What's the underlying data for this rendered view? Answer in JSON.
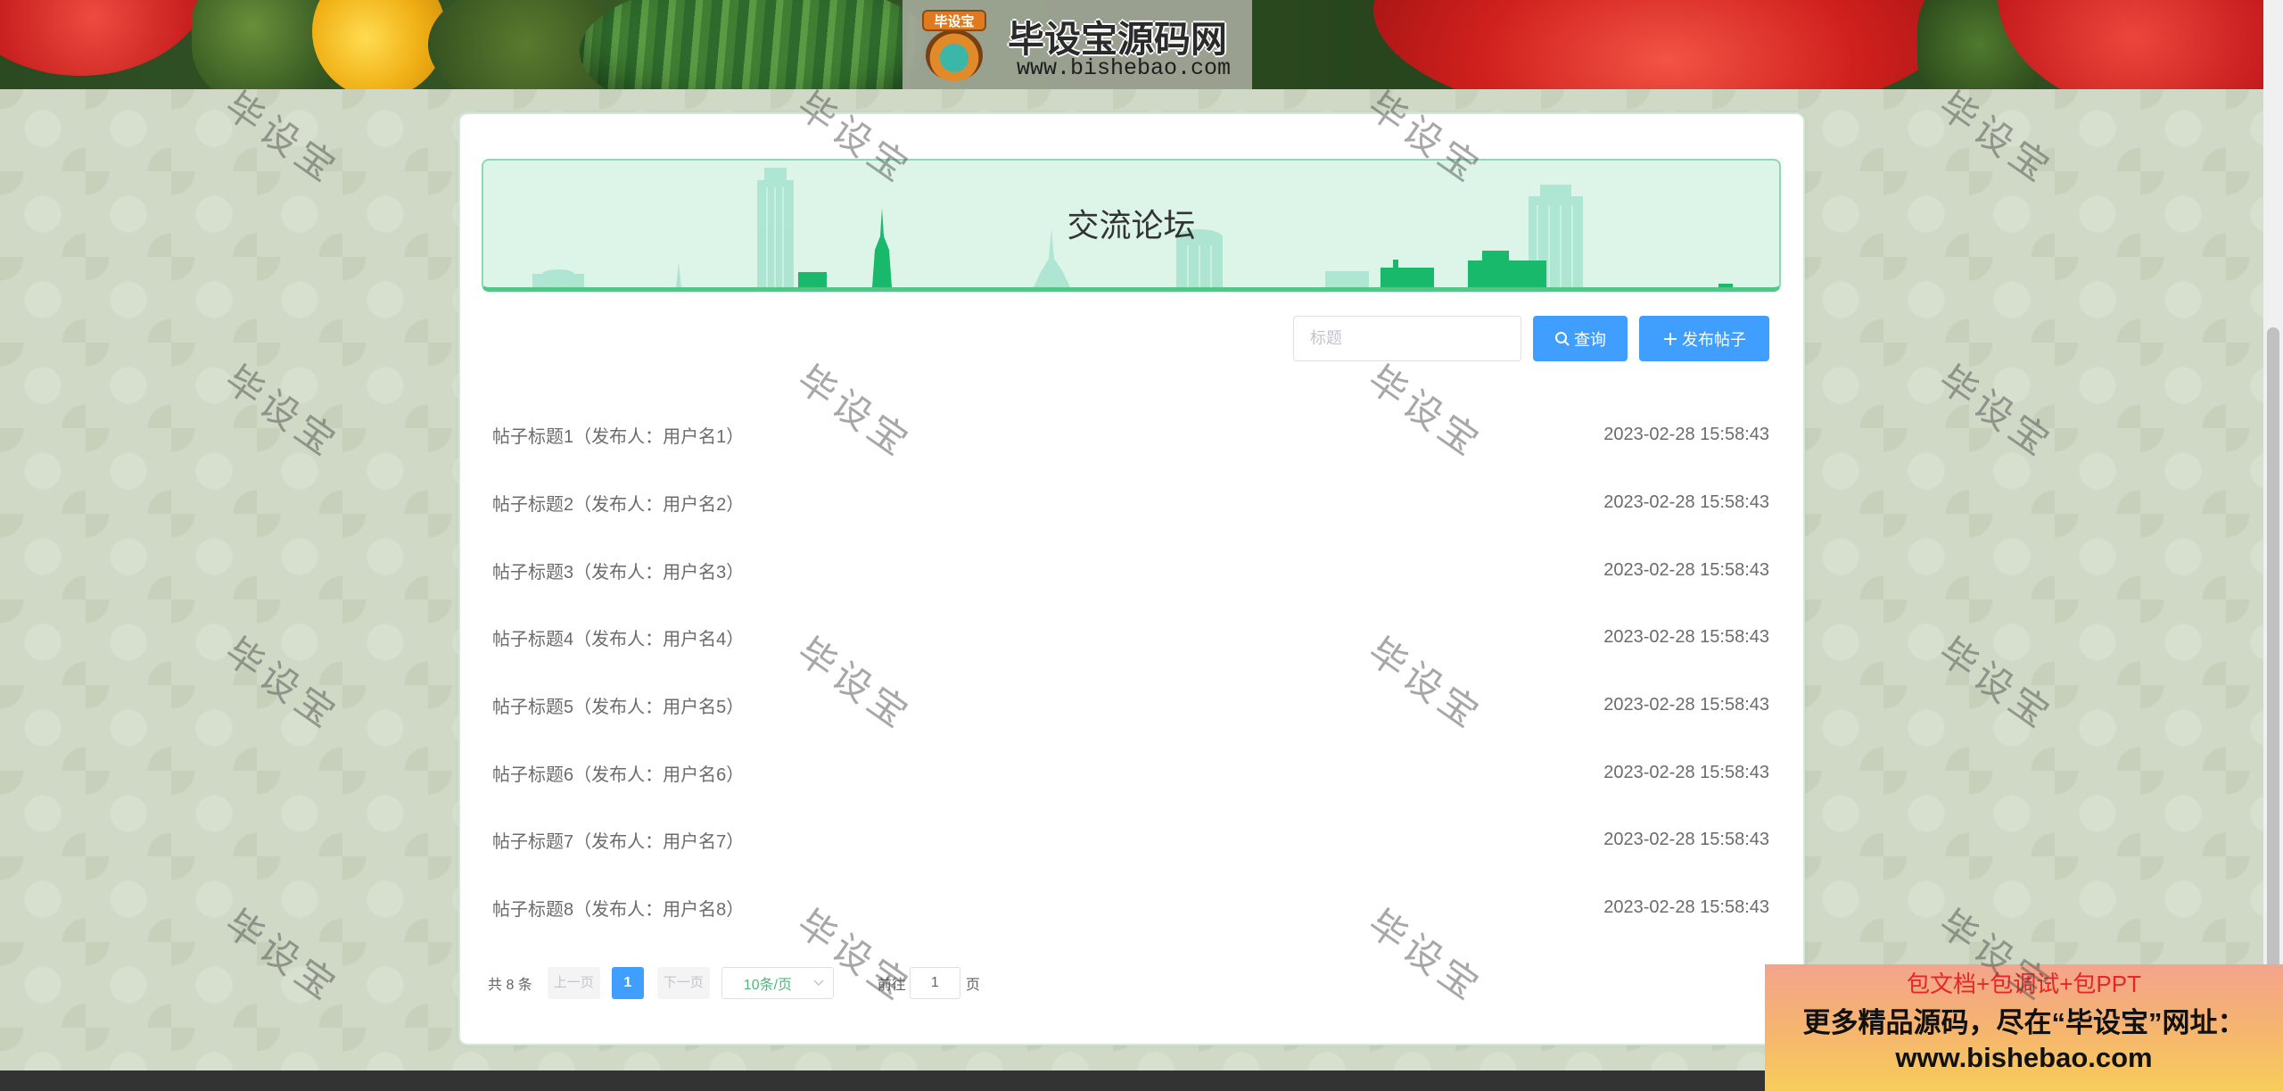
{
  "header": {
    "logo_badge": "毕设宝",
    "logo_title": "毕设宝源码网",
    "logo_url": "www.bishebao.com"
  },
  "forum": {
    "title": "交流论坛",
    "search": {
      "placeholder": "标题",
      "value": ""
    },
    "query_label": "查询",
    "publish_label": "发布帖子",
    "posts": [
      {
        "title": "帖子标题1（发布人：用户名1）",
        "time": "2023-02-28 15:58:43"
      },
      {
        "title": "帖子标题2（发布人：用户名2）",
        "time": "2023-02-28 15:58:43"
      },
      {
        "title": "帖子标题3（发布人：用户名3）",
        "time": "2023-02-28 15:58:43"
      },
      {
        "title": "帖子标题4（发布人：用户名4）",
        "time": "2023-02-28 15:58:43"
      },
      {
        "title": "帖子标题5（发布人：用户名5）",
        "time": "2023-02-28 15:58:43"
      },
      {
        "title": "帖子标题6（发布人：用户名6）",
        "time": "2023-02-28 15:58:43"
      },
      {
        "title": "帖子标题7（发布人：用户名7）",
        "time": "2023-02-28 15:58:43"
      },
      {
        "title": "帖子标题8（发布人：用户名8）",
        "time": "2023-02-28 15:58:43"
      }
    ]
  },
  "pagination": {
    "total": "共 8 条",
    "prev": "上一页",
    "current": "1",
    "next": "下一页",
    "page_size": "10条/页",
    "goto": "前往",
    "goto_value": "1",
    "suffix": "页"
  },
  "watermark": {
    "text": "毕设宝"
  },
  "promo": {
    "line1": "包文档+包调试+包PPT",
    "line2": "更多精品源码，尽在“毕设宝”网址：",
    "line3": "www.bishebao.com"
  },
  "icons": {
    "query": "search-icon",
    "publish": "plus-icon",
    "page_size": "chevron-down-icon"
  },
  "colors": {
    "primary": "#409eff",
    "theme_green": "#52c785",
    "banner_bg": "#dcf5e8",
    "page_bg": "#cfd9c5",
    "promo_red": "#e5262b",
    "footer": "#333333"
  }
}
